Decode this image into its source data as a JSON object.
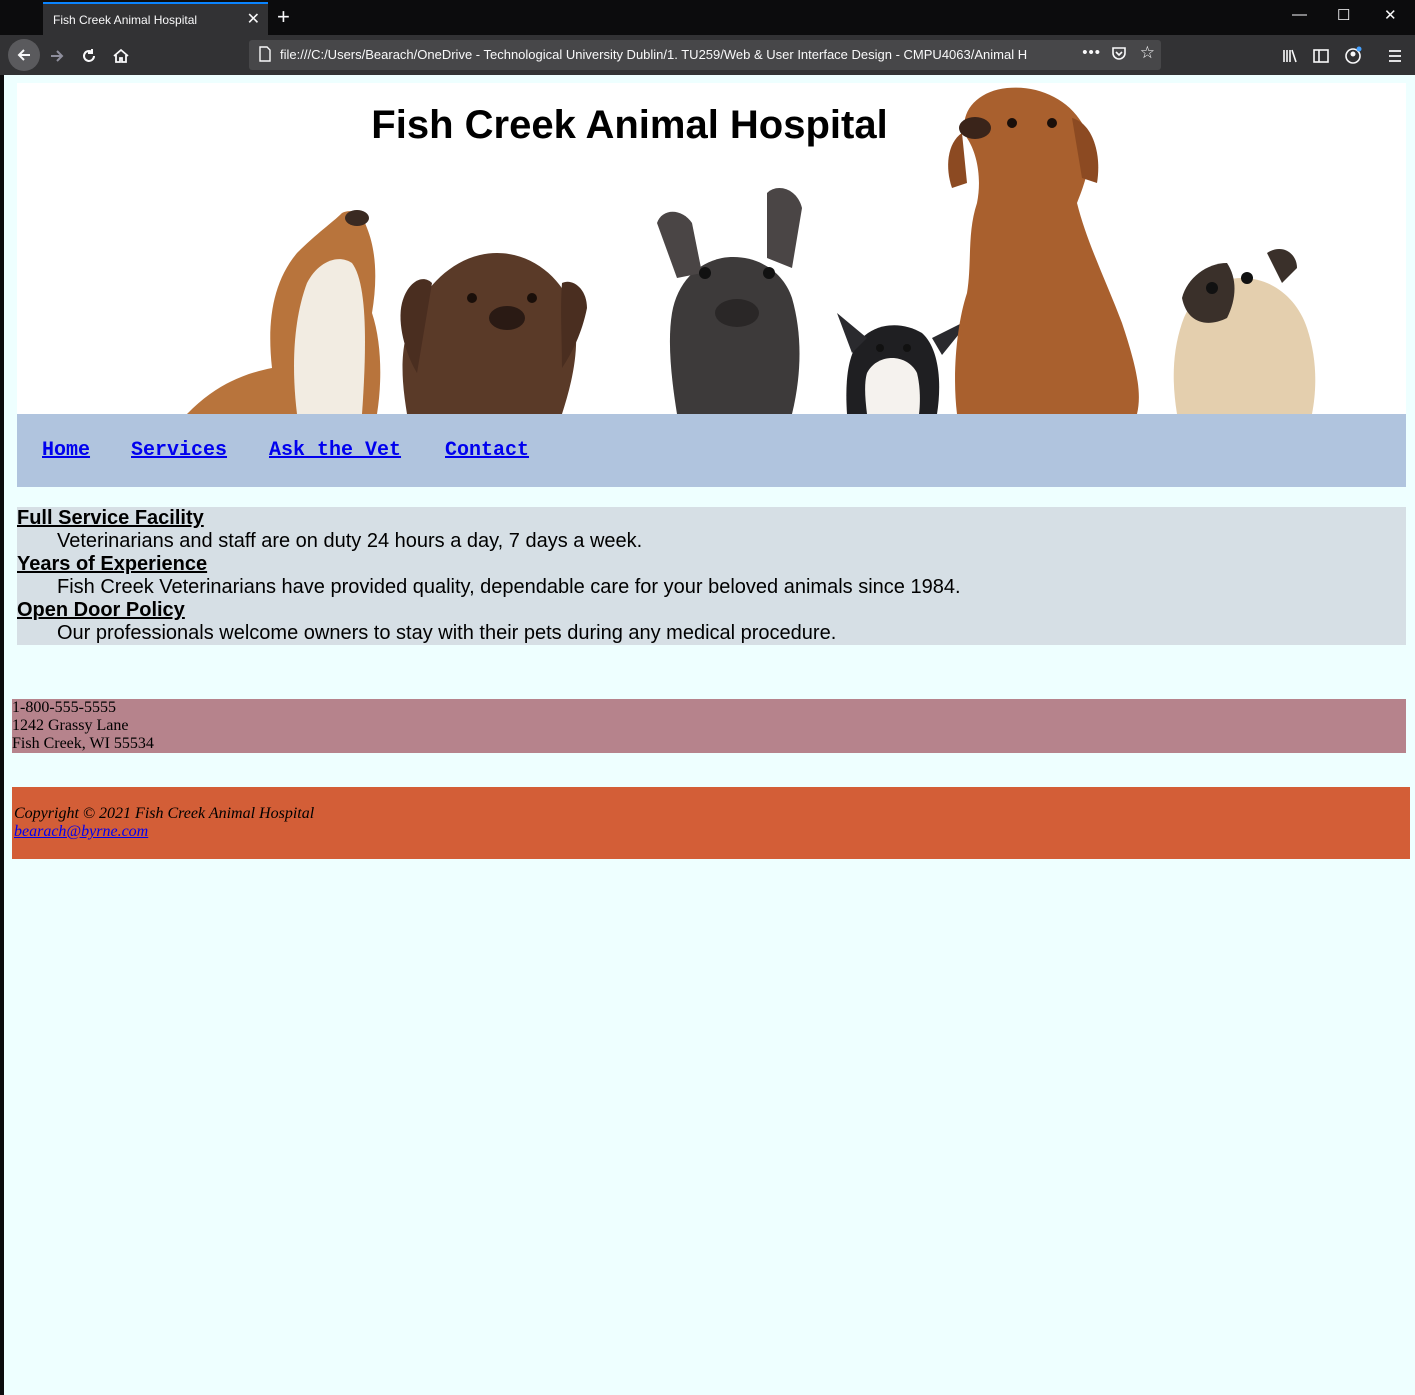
{
  "browser": {
    "tab_title": "Fish Creek Animal Hospital",
    "tab_close": "✕",
    "new_tab": "+",
    "window_controls": {
      "minimize": "—",
      "maximize": "☐",
      "close": "✕"
    },
    "url": "file:///C:/Users/Bearach/OneDrive - Technological University Dublin/1. TU259/Web & User Interface Design - CMPU4063/Animal H",
    "url_more": "•••"
  },
  "page": {
    "title": "Fish Creek Animal Hospital",
    "nav": [
      "Home",
      "Services",
      "Ask the Vet",
      "Contact"
    ],
    "features": [
      {
        "term": "Full Service Facility",
        "desc": "Veterinarians and staff are on duty 24 hours a day, 7 days a week."
      },
      {
        "term": "Years of Experience",
        "desc": "Fish Creek Veterinarians have provided quality, dependable care for your beloved animals since 1984."
      },
      {
        "term": "Open Door Policy",
        "desc": "Our professionals welcome owners to stay with their pets during any medical procedure."
      }
    ],
    "contact": {
      "phone": "1-800-555-5555",
      "street": "1242 Grassy Lane",
      "city": "Fish Creek, WI 55534"
    },
    "footer": {
      "copyright": "Copyright © 2021 Fish Creek Animal Hospital",
      "email": "bearach@byrne.com"
    }
  },
  "colors": {
    "header_bg": "#ffffff",
    "nav_bg": "#b0c4de",
    "content_bg": "#d6dfe5",
    "contact_bg": "#b6838c",
    "footer_bg": "#d35e37",
    "page_bg": "#eeffff",
    "link": "#0000ee"
  }
}
